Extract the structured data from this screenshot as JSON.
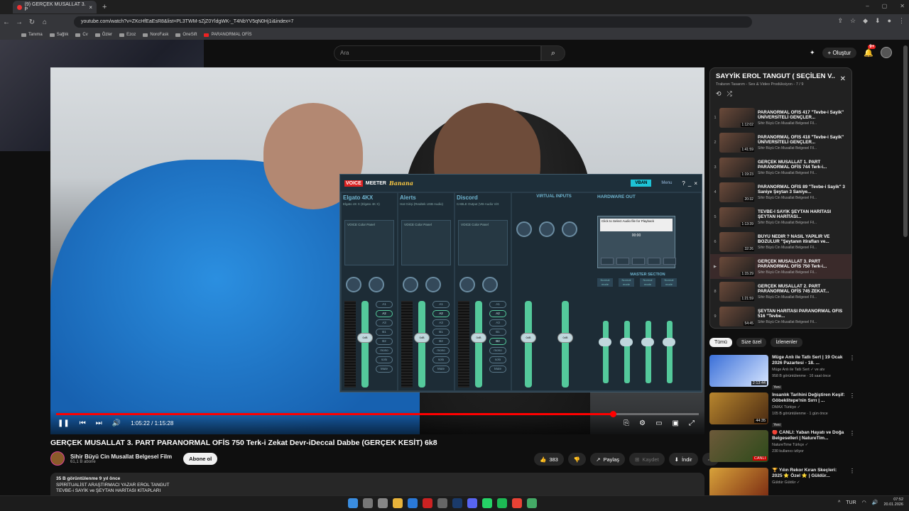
{
  "browser": {
    "tab_title": "(9) GERÇEK MUSALLAT 3. P",
    "url": "youtube.com/watch?v=ZKcHfEaEsR8&list=PL3TWM-sZjZ0YldgWK-_T4NbYV5qN0Hj1i&index=7",
    "bookmarks": [
      "Tanıma",
      "Sağlık",
      "Cv",
      "Özler",
      "Ezoz",
      "NoroFask",
      "OneSift",
      "PARANORMAL OFİS"
    ]
  },
  "youtube": {
    "search_placeholder": "Ara",
    "create_label": "Oluştur",
    "notif_count": "9+"
  },
  "voicemeeter": {
    "logo1": "VOICE",
    "logo2": "MEETER",
    "logo3": "Banana",
    "vban": "VBAN",
    "menu": "Menu",
    "strips": [
      {
        "name": "Elgato 4KX",
        "device": "Elgato 4K X (Elgato 4K X)",
        "label": "Elgato 4KX"
      },
      {
        "name": "Alerts",
        "device": "Hat Girişi (Realtek USB Audio)",
        "label": "Alerts"
      },
      {
        "name": "Discord",
        "device": "CABLE Output (VB-Audio Virt",
        "label": "Discord"
      }
    ],
    "strip_panel": "INTELLIPAN",
    "voice_label": "VOICE   Color Panel",
    "virtual_inputs": "VIRTUAL INPUTS",
    "hardware_out": "HARDWARE OUT",
    "master_section": "MASTER SECTION",
    "tape_text": "Click to Select Audio file for Playback",
    "tape_time": "00:00",
    "fader_value": "0dB",
    "buttons": [
      "A1",
      "A2",
      "A3",
      "B1",
      "B2",
      "mono",
      "solo",
      "Mute"
    ],
    "mode_label": "Normal mode"
  },
  "player": {
    "current_time": "1:05:22",
    "total_time": "1:15:28",
    "progress": 0.866
  },
  "video": {
    "title": "GERÇEK MUSALLAT 3. PART PARANORMAL OFİS 750 Terk-i Zekat Devr-iDeccal Dabbe (GERÇEK KESİT) 6k8",
    "channel": "Sihir Büyü Cin Musallat Belgesel Film",
    "subscribers": "61,1 B abone",
    "subscribe_label": "Abone ol",
    "likes": "383",
    "share": "Paylaş",
    "save": "Kaydet",
    "download": "İndir",
    "desc_line1": "35 B görüntülenme  9 yıl önce",
    "desc_line2": "SPİRİTUALİST ARAŞTIRMACI YAZAR EROL TANGUT",
    "desc_line3": "TEVBE-i SAYİK ve ŞEYTAN HARİTASI KİTAPLARI"
  },
  "playlist": {
    "title": "SAYYİK EROL TANGUT ( SEÇİLEN V...",
    "subtitle": "Trabzon Tasarım - Ses & Video Prodüksiyon - 7 / 9",
    "items": [
      {
        "num": "1",
        "title": "PARANORMAL OFİS 417 \"Tevbe-i Sayik\" ÜNİVERSİTELİ GENÇLER...",
        "channel": "Sihir Büyü Cin Musallat Belgesel Fil...",
        "dur": "1:12:02"
      },
      {
        "num": "2",
        "title": "PARANORMAL OFİS 418 \"Tevbe-i Sayik\" ÜNİVERSİTELİ GENÇLER...",
        "channel": "Sihir Büyü Cin Musallat Belgesel Fil...",
        "dur": "1:41:59"
      },
      {
        "num": "3",
        "title": "GERÇEK MUSALLAT 1. PART PARANORMAL OFİS 744 Terk-i...",
        "channel": "Sihir Büyü Cin Musallat Belgesel Fil...",
        "dur": "1:19:23"
      },
      {
        "num": "4",
        "title": "PARANORMAL OFİS 89 \"Tevbe-i Sayik\" 3 Saniye Şeytan 3 Saniye...",
        "channel": "Sihir Büyü Cin Musallat Belgesel Fil...",
        "dur": "20:32"
      },
      {
        "num": "5",
        "title": "TEVBE-İ SAYİK ŞEYTAN HARİTASI ŞEYTAN HARİTASI...",
        "channel": "Sihir Büyü Cin Musallat Belgesel Fil...",
        "dur": "1:13:39"
      },
      {
        "num": "6",
        "title": "BÜYÜ NEDİR ? NASIL YAPILIR VE BOZULUR \"Şeytanın itirafları ve...",
        "channel": "Sihir Büyü Cin Musallat Belgesel Fil...",
        "dur": "32:26"
      },
      {
        "num": "▶",
        "title": "GERÇEK MUSALLAT 3. PART PARANORMAL OFİS 750 Terk-i...",
        "channel": "Sihir Büyü Cin Musallat Belgesel Fil...",
        "dur": "1:15:29"
      },
      {
        "num": "8",
        "title": "GERÇEK MUSALLAT 2. PART PARANORMAL OFİS 745 ZEKAT...",
        "channel": "Sihir Büyü Cin Musallat Belgesel Fil...",
        "dur": "1:21:59"
      },
      {
        "num": "9",
        "title": "ŞEYTAN HARİTASI PARANORMAL OFİS 516 \"Tevbe...",
        "channel": "Sihir Büyü Cin Musallat Belgesel Fil...",
        "dur": "54:45"
      }
    ]
  },
  "chips": [
    "Tümü",
    "Size özel",
    "İzlenenler"
  ],
  "recommendations": [
    {
      "title": "Müge Anlı ile Tatlı Sert | 19 Ocak 2026 Pazartesi - 18. ...",
      "channel": "Müge Anlı ile Tatlı Sert ✓ ve atv",
      "meta": "958 B görüntülenme · 16 saat önce",
      "badge": "Yeni",
      "dur": "2:13:44"
    },
    {
      "title": "İnsanlık Tarihini Değiştiren Keşif: Göbeklitepe'nin Sırrı | ...",
      "channel": "DMAX Türkiye ✓",
      "meta": "105 B görüntülenme · 1 gün önce",
      "badge": "Yeni",
      "dur": "44:35"
    },
    {
      "title": "🔴 CANLI: Yaban Hayatı ve Doğa Belgeselleri | NatureTim...",
      "channel": "NatureTime Türkçe ✓",
      "meta": "230 kullanıcı izliyor",
      "badge": "",
      "dur": "CANLI"
    },
    {
      "title": "🏆 Yılın Rekor Kıran Skeçleri: 2025 ⭐ Özel ⭐ | Güldür...",
      "channel": "Güldür Güldür ✓",
      "meta": "",
      "badge": "",
      "dur": ""
    }
  ],
  "tray": {
    "lang": "TUR",
    "time": "07:52",
    "date": "20.01.2026"
  }
}
